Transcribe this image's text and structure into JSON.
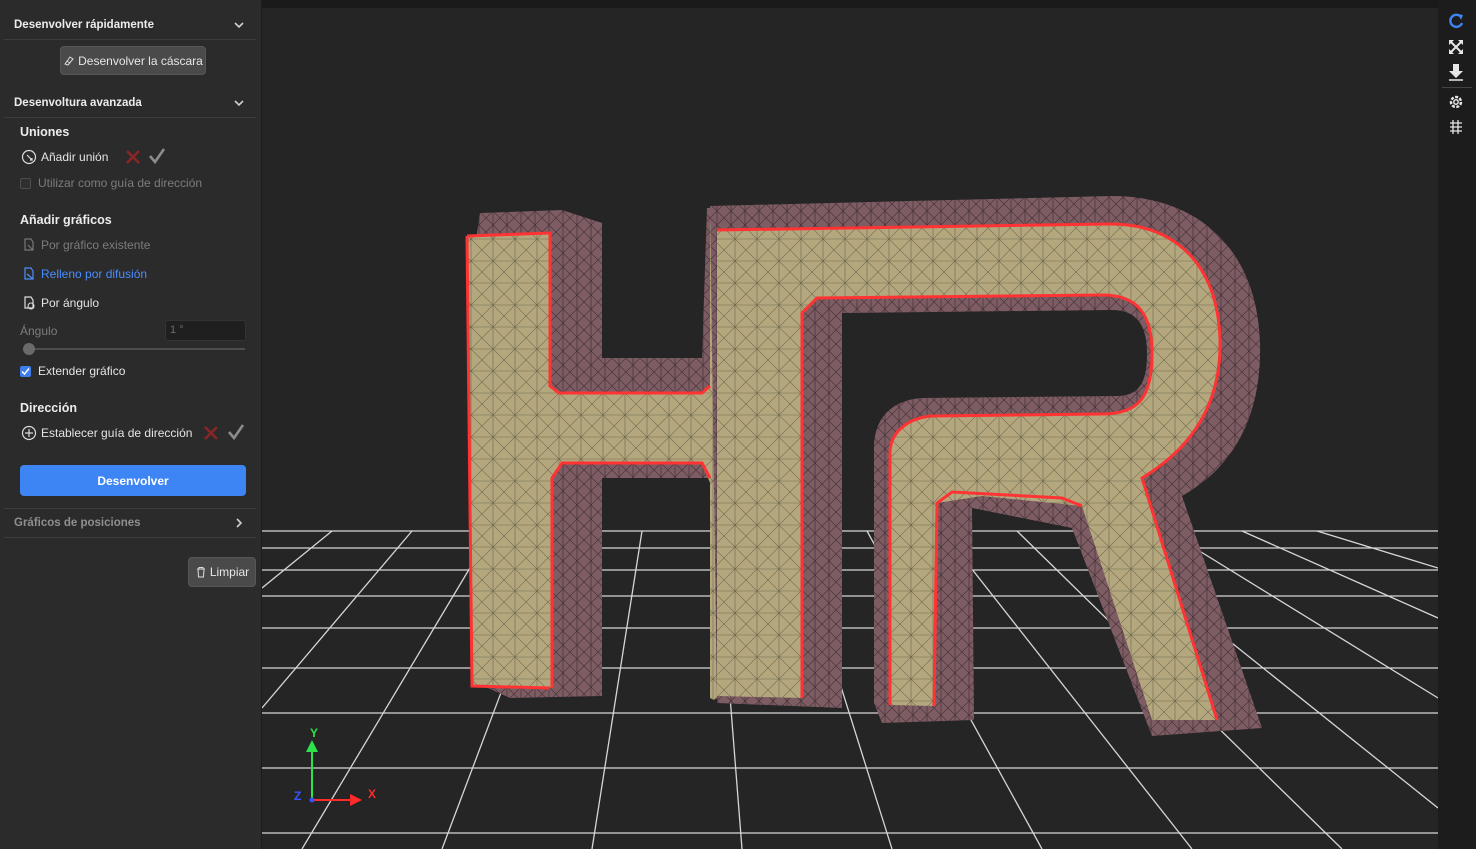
{
  "panel": {
    "quick_unwrap": {
      "title": "Desenvolver rápidamente",
      "button_label": "Desenvolver la cáscara"
    },
    "advanced": {
      "title": "Desenvoltura avanzada",
      "seams": {
        "title": "Uniones",
        "add_seam_label": "Añadir unión",
        "direction_guide_checkbox_label": "Utilizar como guía de dirección"
      },
      "add_graphics": {
        "title": "Añadir gráficos",
        "by_existing_label": "Por gráfico existente",
        "diffusion_fill_label": "Relleno por difusión",
        "by_angle_label": "Por ángulo",
        "angle_label": "Ángulo",
        "angle_value": "1 °",
        "angle_slider_fraction": 0.0,
        "extend_graphic_label": "Extender gráfico"
      },
      "direction": {
        "title": "Dirección",
        "set_guide_label": "Establecer guía de dirección"
      },
      "unwrap_button_label": "Desenvolver"
    },
    "position_graphics": {
      "title": "Gráficos de posiciones"
    },
    "clear_button_label": "Limpiar"
  },
  "viewport": {
    "axes": {
      "y": "Y",
      "x": "X",
      "z": "Z"
    },
    "colors": {
      "face": "#b4a77e",
      "side": "#7d5c63",
      "seam": "#ff3333",
      "grid": "#e0e0e0",
      "background": "#252525"
    }
  },
  "toolbar": {
    "icons": [
      "refresh-icon",
      "fit-view-icon",
      "drop-to-floor-icon",
      "settings-icon",
      "grid-view-icon"
    ]
  }
}
